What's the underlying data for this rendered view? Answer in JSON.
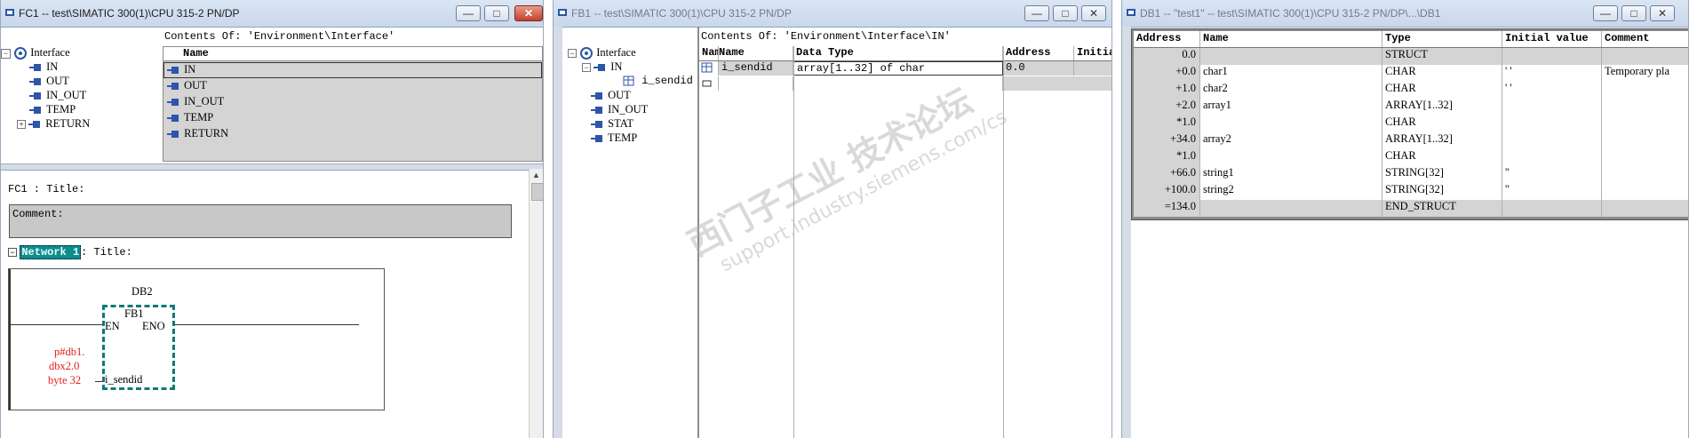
{
  "fc1": {
    "title": "FC1 -- test\\SIMATIC 300(1)\\CPU 315-2 PN/DP",
    "contents_label": "Contents Of: 'Environment\\Interface'",
    "tree": [
      "Interface",
      "IN",
      "OUT",
      "IN_OUT",
      "TEMP",
      "RETURN"
    ],
    "list_header": "Name",
    "list_items": [
      "IN",
      "OUT",
      "IN_OUT",
      "TEMP",
      "RETURN"
    ],
    "block_title": "FC1 : Title:",
    "comment_label": "Comment:",
    "network_label": "Network 1",
    "network_title": ": Title:",
    "instance_db": "DB2",
    "fb_name": "FB1",
    "pin_en": "EN",
    "pin_eno": "ENO",
    "pin_in": "i_sendid",
    "operand_lines": [
      "p#db1.",
      "dbx2.0",
      "byte 32"
    ]
  },
  "fb1": {
    "title": "FB1 -- test\\SIMATIC 300(1)\\CPU 315-2 PN/DP",
    "contents_label": "Contents Of: 'Environment\\Interface\\IN'",
    "tree": [
      "Interface",
      "IN",
      "i_sendid",
      "OUT",
      "IN_OUT",
      "STAT",
      "TEMP"
    ],
    "columns": [
      "Name",
      "Data Type",
      "Address",
      "Initia"
    ],
    "row": {
      "name": "i_sendid",
      "data_type": "array[1..32] of char",
      "address": "0.0"
    }
  },
  "db1": {
    "title": "DB1 -- \"test1\" -- test\\SIMATIC 300(1)\\CPU 315-2 PN/DP\\...\\DB1",
    "columns": [
      "Address",
      "Name",
      "Type",
      "Initial value",
      "Comment"
    ],
    "rows": [
      {
        "address": "0.0",
        "name": "",
        "type": "STRUCT",
        "init": "",
        "comment": ""
      },
      {
        "address": "+0.0",
        "name": "char1",
        "type": "CHAR",
        "init": "' '",
        "comment": "Temporary pla"
      },
      {
        "address": "+1.0",
        "name": "char2",
        "type": "CHAR",
        "init": "' '",
        "comment": ""
      },
      {
        "address": "+2.0",
        "name": "array1",
        "type": "ARRAY[1..32]",
        "init": "",
        "comment": ""
      },
      {
        "address": "*1.0",
        "name": "",
        "type": "CHAR",
        "init": "",
        "comment": ""
      },
      {
        "address": "+34.0",
        "name": "array2",
        "type": "ARRAY[1..32]",
        "init": "",
        "comment": ""
      },
      {
        "address": "*1.0",
        "name": "",
        "type": "CHAR",
        "init": "",
        "comment": ""
      },
      {
        "address": "+66.0",
        "name": "string1",
        "type": "STRING[32]",
        "init": "''",
        "comment": ""
      },
      {
        "address": "+100.0",
        "name": "string2",
        "type": "STRING[32]",
        "init": "''",
        "comment": ""
      },
      {
        "address": "=134.0",
        "name": "",
        "type": "END_STRUCT",
        "init": "",
        "comment": ""
      }
    ]
  },
  "watermark": {
    "line1": "西门子工业 技术论坛",
    "line2": "support.industry.siemens.com/cs"
  },
  "colors": {
    "accent_teal": "#007a7a",
    "operand_red": "#e0201c",
    "selection_gray": "#d4d4d4"
  }
}
